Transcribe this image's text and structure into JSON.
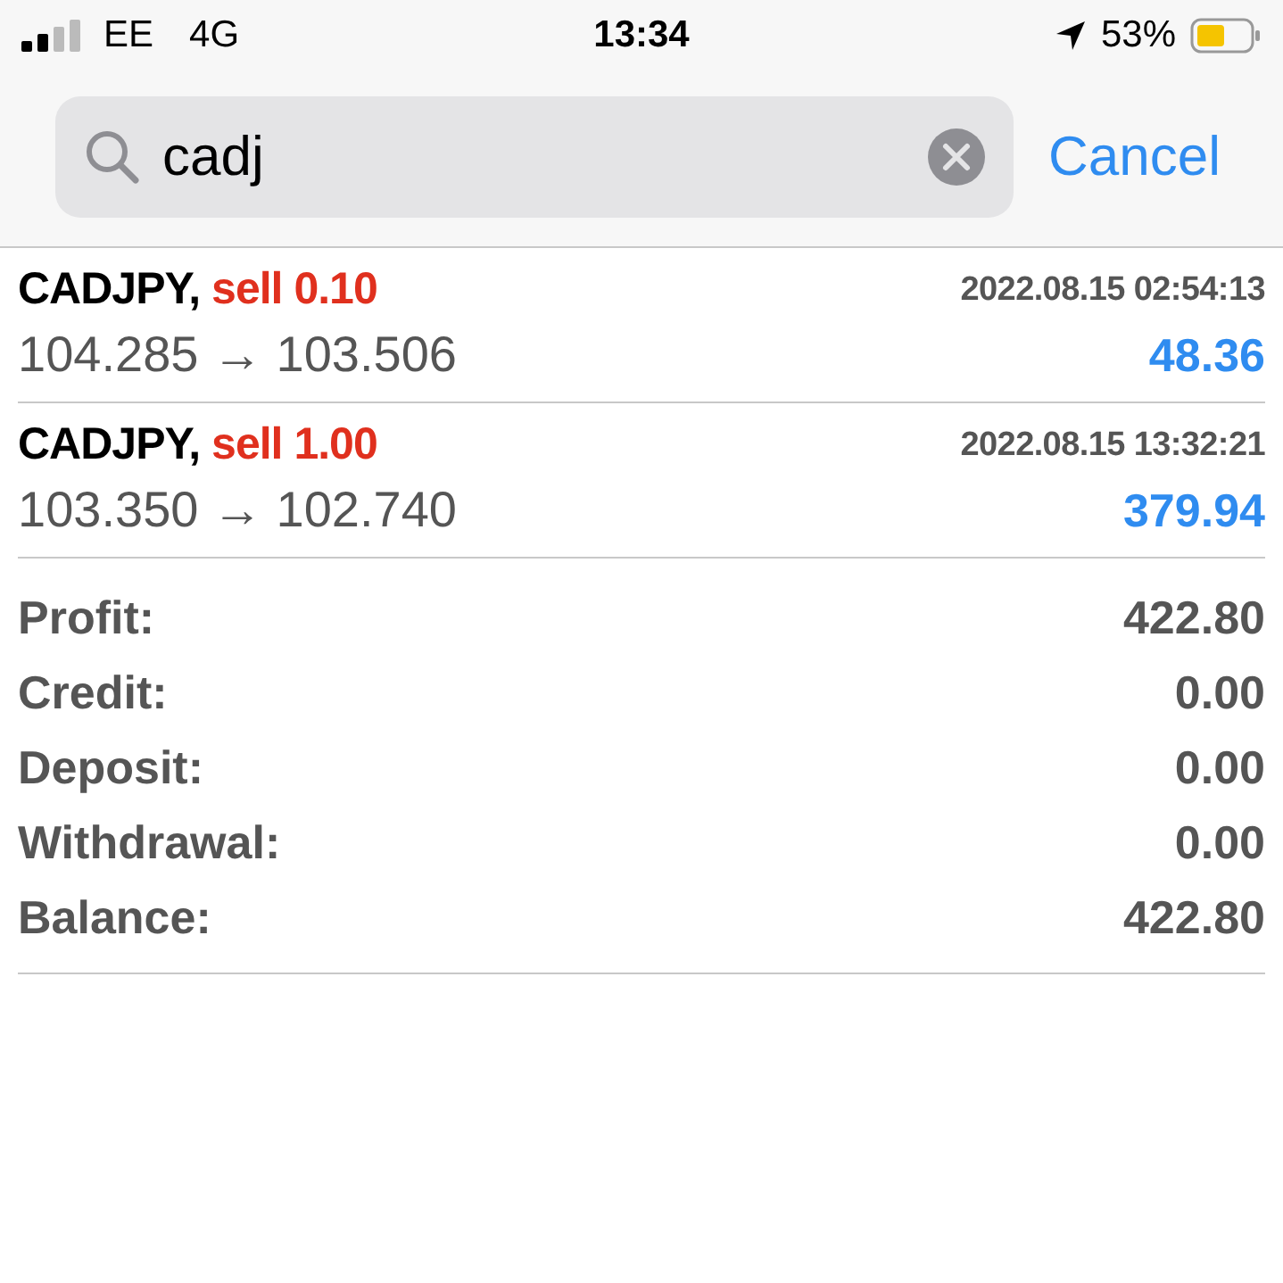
{
  "status_bar": {
    "carrier": "EE",
    "network": "4G",
    "time": "13:34",
    "battery": "53%"
  },
  "search": {
    "value": "cadj",
    "cancel": "Cancel"
  },
  "deals": [
    {
      "symbol": "CADJPY,",
      "side": "sell 0.10",
      "prices": "104.285 → 103.506",
      "time": "2022.08.15 02:54:13",
      "profit": "48.36"
    },
    {
      "symbol": "CADJPY,",
      "side": "sell 1.00",
      "prices": "103.350 → 102.740",
      "time": "2022.08.15 13:32:21",
      "profit": "379.94"
    }
  ],
  "summary": [
    {
      "label": "Profit:",
      "value": "422.80"
    },
    {
      "label": "Credit:",
      "value": "0.00"
    },
    {
      "label": "Deposit:",
      "value": "0.00"
    },
    {
      "label": "Withdrawal:",
      "value": "0.00"
    },
    {
      "label": "Balance:",
      "value": "422.80"
    }
  ]
}
